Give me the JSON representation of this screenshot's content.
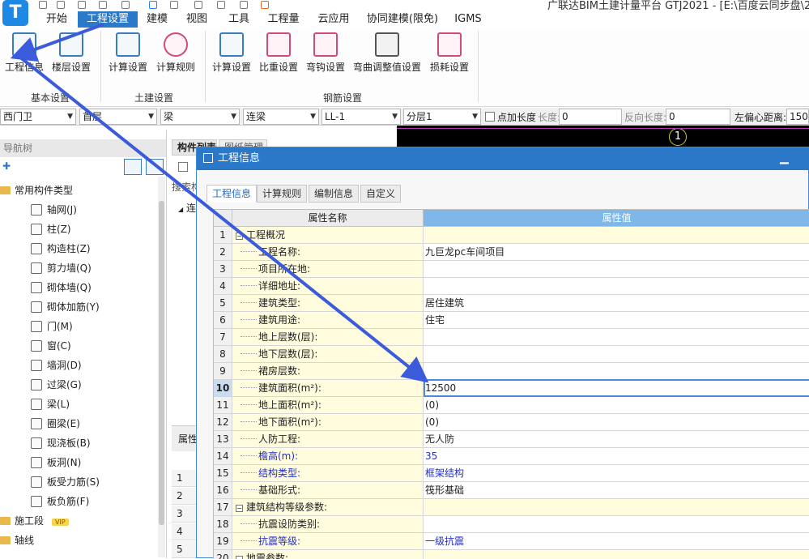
{
  "app": {
    "logo_letter": "T",
    "title": "广联达BIM土建计量平台 GTJ2021 - [E:\\百度云同步盘\\2020\\"
  },
  "menu": [
    "开始",
    "工程设置",
    "建模",
    "视图",
    "工具",
    "工程量",
    "云应用",
    "协同建模(限免)",
    "IGMS"
  ],
  "ribbon": {
    "buttons": [
      "工程信息",
      "楼层设置",
      "计算设置",
      "计算规则",
      "计算设置",
      "比重设置",
      "弯钩设置",
      "弯曲调整值设置",
      "损耗设置"
    ],
    "groups": [
      "基本设置",
      "土建设置",
      "钢筋设置"
    ]
  },
  "filters": {
    "component": "西门卫",
    "floor": "首层",
    "type": "梁",
    "subtype": "连梁",
    "name": "LL-1",
    "layer": "分层1",
    "point_length_label": "点加长度",
    "length_label": "长度:",
    "length_value": "0",
    "dir_length_label": "反向长度:",
    "dir_length_value": "0",
    "offset_label": "左偏心距离:",
    "offset_value": "150"
  },
  "nav": {
    "title": "导航树",
    "category": "常用构件类型",
    "items": [
      "轴网(J)",
      "柱(Z)",
      "构造柱(Z)",
      "剪力墙(Q)",
      "砌体墙(Q)",
      "砌体加筋(Y)",
      "门(M)",
      "窗(C)",
      "墙洞(D)",
      "过梁(G)",
      "梁(L)",
      "圈梁(E)",
      "现浇板(B)",
      "板洞(N)",
      "板受力筋(S)",
      "板负筋(F)"
    ],
    "bottom": [
      "施工段",
      "轴线"
    ],
    "vip": "VIP"
  },
  "mid": {
    "tab1": "构件列表",
    "tab2": "图纸管理",
    "search": "搜索构",
    "tree": "连",
    "prop": "属性",
    "canvas_marker": "1",
    "rows": [
      "1",
      "2",
      "3",
      "4",
      "5"
    ]
  },
  "dialog": {
    "title": "工程信息",
    "tabs": [
      "工程信息",
      "计算规则",
      "编制信息",
      "自定义"
    ],
    "headers": {
      "name": "属性名称",
      "value": "属性值"
    },
    "rows": [
      {
        "n": "1",
        "name": "工程概况",
        "value": "",
        "group": true,
        "blue": false
      },
      {
        "n": "2",
        "name": "工程名称:",
        "value": "九巨龙pc车间项目",
        "group": false,
        "blue": false
      },
      {
        "n": "3",
        "name": "项目所在地:",
        "value": "",
        "group": false,
        "blue": false
      },
      {
        "n": "4",
        "name": "详细地址:",
        "value": "",
        "group": false,
        "blue": false
      },
      {
        "n": "5",
        "name": "建筑类型:",
        "value": "居住建筑",
        "group": false,
        "blue": false
      },
      {
        "n": "6",
        "name": "建筑用途:",
        "value": "住宅",
        "group": false,
        "blue": false
      },
      {
        "n": "7",
        "name": "地上层数(层):",
        "value": "",
        "group": false,
        "blue": false
      },
      {
        "n": "8",
        "name": "地下层数(层):",
        "value": "",
        "group": false,
        "blue": false
      },
      {
        "n": "9",
        "name": "裙房层数:",
        "value": "",
        "group": false,
        "blue": false
      },
      {
        "n": "10",
        "name": "建筑面积(m²):",
        "value": "12500",
        "group": false,
        "blue": false,
        "selected": true
      },
      {
        "n": "11",
        "name": "地上面积(m²):",
        "value": "(0)",
        "group": false,
        "blue": false
      },
      {
        "n": "12",
        "name": "地下面积(m²):",
        "value": "(0)",
        "group": false,
        "blue": false
      },
      {
        "n": "13",
        "name": "人防工程:",
        "value": "无人防",
        "group": false,
        "blue": false
      },
      {
        "n": "14",
        "name": "檐高(m):",
        "value": "35",
        "group": false,
        "blue": true
      },
      {
        "n": "15",
        "name": "结构类型:",
        "value": "框架结构",
        "group": false,
        "blue": true
      },
      {
        "n": "16",
        "name": "基础形式:",
        "value": "筏形基础",
        "group": false,
        "blue": false
      },
      {
        "n": "17",
        "name": "建筑结构等级参数:",
        "value": "",
        "group": true,
        "blue": false
      },
      {
        "n": "18",
        "name": "抗震设防类别:",
        "value": "",
        "group": false,
        "blue": false
      },
      {
        "n": "19",
        "name": "抗震等级:",
        "value": "一级抗震",
        "group": false,
        "blue": true
      },
      {
        "n": "20",
        "name": "地震参数:",
        "value": "",
        "group": true,
        "blue": false
      }
    ]
  },
  "colors": {
    "accent": "#2b79c9",
    "annotation_arrow": "#3b5bdb"
  }
}
